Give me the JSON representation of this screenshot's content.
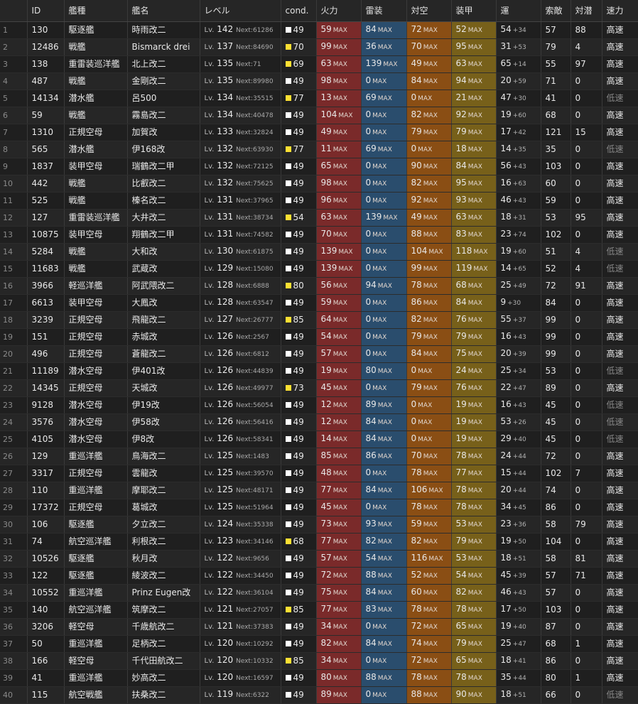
{
  "colors": {
    "fire": "#7a2a2a",
    "torp": "#2a4d6d",
    "aa": "#8a4e14",
    "armor": "#77601a",
    "cond_normal": "#ffffff",
    "cond_sparkle": "#ffe033"
  },
  "headers": [
    "",
    "ID",
    "艦種",
    "艦名",
    "レベル",
    "cond.",
    "火力",
    "雷装",
    "対空",
    "装甲",
    "運",
    "索敵",
    "対潜",
    "速力"
  ],
  "labels": {
    "lv": "Lv.",
    "next": "Next:",
    "max": "MAX"
  },
  "ships": [
    {
      "idx": "1",
      "id": "130",
      "type": "駆逐艦",
      "name": "時雨改二",
      "lv": "142",
      "next": "61286",
      "cond": "49",
      "fire": "59",
      "torp": "84",
      "aa": "72",
      "armor": "52",
      "luck": "54",
      "luck_bonus": "+34",
      "los": "57",
      "asw": "88",
      "speed": "高速"
    },
    {
      "idx": "2",
      "id": "12486",
      "type": "戦艦",
      "name": "Bismarck drei",
      "lv": "137",
      "next": "84690",
      "cond": "70",
      "fire": "99",
      "torp": "36",
      "aa": "70",
      "armor": "95",
      "luck": "31",
      "luck_bonus": "+53",
      "los": "79",
      "asw": "4",
      "speed": "高速"
    },
    {
      "idx": "3",
      "id": "138",
      "type": "重雷装巡洋艦",
      "name": "北上改二",
      "lv": "135",
      "next": "71",
      "cond": "69",
      "fire": "63",
      "torp": "139",
      "aa": "49",
      "armor": "63",
      "luck": "65",
      "luck_bonus": "+14",
      "los": "55",
      "asw": "97",
      "speed": "高速"
    },
    {
      "idx": "4",
      "id": "487",
      "type": "戦艦",
      "name": "金剛改二",
      "lv": "135",
      "next": "89980",
      "cond": "49",
      "fire": "98",
      "torp": "0",
      "aa": "84",
      "armor": "94",
      "luck": "20",
      "luck_bonus": "+59",
      "los": "71",
      "asw": "0",
      "speed": "高速"
    },
    {
      "idx": "5",
      "id": "14134",
      "type": "潜水艦",
      "name": "呂500",
      "lv": "134",
      "next": "35515",
      "cond": "77",
      "fire": "13",
      "torp": "69",
      "aa": "0",
      "armor": "21",
      "luck": "47",
      "luck_bonus": "+30",
      "los": "41",
      "asw": "0",
      "speed": "低速"
    },
    {
      "idx": "6",
      "id": "59",
      "type": "戦艦",
      "name": "霧島改二",
      "lv": "134",
      "next": "40478",
      "cond": "49",
      "fire": "104",
      "torp": "0",
      "aa": "82",
      "armor": "92",
      "luck": "19",
      "luck_bonus": "+60",
      "los": "68",
      "asw": "0",
      "speed": "高速"
    },
    {
      "idx": "7",
      "id": "1310",
      "type": "正規空母",
      "name": "加賀改",
      "lv": "133",
      "next": "32824",
      "cond": "49",
      "fire": "49",
      "torp": "0",
      "aa": "79",
      "armor": "79",
      "luck": "17",
      "luck_bonus": "+42",
      "los": "121",
      "asw": "15",
      "speed": "高速"
    },
    {
      "idx": "8",
      "id": "565",
      "type": "潜水艦",
      "name": "伊168改",
      "lv": "132",
      "next": "63930",
      "cond": "77",
      "fire": "11",
      "torp": "69",
      "aa": "0",
      "armor": "18",
      "luck": "14",
      "luck_bonus": "+35",
      "los": "35",
      "asw": "0",
      "speed": "低速"
    },
    {
      "idx": "9",
      "id": "1837",
      "type": "装甲空母",
      "name": "瑞鶴改二甲",
      "lv": "132",
      "next": "72125",
      "cond": "49",
      "fire": "65",
      "torp": "0",
      "aa": "90",
      "armor": "84",
      "luck": "56",
      "luck_bonus": "+43",
      "los": "103",
      "asw": "0",
      "speed": "高速"
    },
    {
      "idx": "10",
      "id": "442",
      "type": "戦艦",
      "name": "比叡改二",
      "lv": "132",
      "next": "75625",
      "cond": "49",
      "fire": "98",
      "torp": "0",
      "aa": "82",
      "armor": "95",
      "luck": "16",
      "luck_bonus": "+63",
      "los": "60",
      "asw": "0",
      "speed": "高速"
    },
    {
      "idx": "11",
      "id": "525",
      "type": "戦艦",
      "name": "榛名改二",
      "lv": "131",
      "next": "37965",
      "cond": "49",
      "fire": "96",
      "torp": "0",
      "aa": "92",
      "armor": "93",
      "luck": "46",
      "luck_bonus": "+43",
      "los": "59",
      "asw": "0",
      "speed": "高速"
    },
    {
      "idx": "12",
      "id": "127",
      "type": "重雷装巡洋艦",
      "name": "大井改二",
      "lv": "131",
      "next": "38734",
      "cond": "54",
      "fire": "63",
      "torp": "139",
      "aa": "49",
      "armor": "63",
      "luck": "18",
      "luck_bonus": "+31",
      "los": "53",
      "asw": "95",
      "speed": "高速"
    },
    {
      "idx": "13",
      "id": "10875",
      "type": "装甲空母",
      "name": "翔鶴改二甲",
      "lv": "131",
      "next": "74582",
      "cond": "49",
      "fire": "70",
      "torp": "0",
      "aa": "88",
      "armor": "83",
      "luck": "23",
      "luck_bonus": "+74",
      "los": "102",
      "asw": "0",
      "speed": "高速"
    },
    {
      "idx": "14",
      "id": "5284",
      "type": "戦艦",
      "name": "大和改",
      "lv": "130",
      "next": "61875",
      "cond": "49",
      "fire": "139",
      "torp": "0",
      "aa": "104",
      "armor": "118",
      "luck": "19",
      "luck_bonus": "+60",
      "los": "51",
      "asw": "4",
      "speed": "低速"
    },
    {
      "idx": "15",
      "id": "11683",
      "type": "戦艦",
      "name": "武蔵改",
      "lv": "129",
      "next": "15080",
      "cond": "49",
      "fire": "139",
      "torp": "0",
      "aa": "99",
      "armor": "119",
      "luck": "14",
      "luck_bonus": "+65",
      "los": "52",
      "asw": "4",
      "speed": "低速"
    },
    {
      "idx": "16",
      "id": "3966",
      "type": "軽巡洋艦",
      "name": "阿武隈改二",
      "lv": "128",
      "next": "6888",
      "cond": "80",
      "fire": "56",
      "torp": "94",
      "aa": "78",
      "armor": "68",
      "luck": "25",
      "luck_bonus": "+49",
      "los": "72",
      "asw": "91",
      "speed": "高速"
    },
    {
      "idx": "17",
      "id": "6613",
      "type": "装甲空母",
      "name": "大鳳改",
      "lv": "128",
      "next": "63547",
      "cond": "49",
      "fire": "59",
      "torp": "0",
      "aa": "86",
      "armor": "84",
      "luck": "9",
      "luck_bonus": "+30",
      "los": "84",
      "asw": "0",
      "speed": "高速"
    },
    {
      "idx": "18",
      "id": "3239",
      "type": "正規空母",
      "name": "飛龍改二",
      "lv": "127",
      "next": "26777",
      "cond": "85",
      "fire": "64",
      "torp": "0",
      "aa": "82",
      "armor": "76",
      "luck": "55",
      "luck_bonus": "+37",
      "los": "99",
      "asw": "0",
      "speed": "高速"
    },
    {
      "idx": "19",
      "id": "151",
      "type": "正規空母",
      "name": "赤城改",
      "lv": "126",
      "next": "2567",
      "cond": "49",
      "fire": "54",
      "torp": "0",
      "aa": "79",
      "armor": "79",
      "luck": "16",
      "luck_bonus": "+43",
      "los": "99",
      "asw": "0",
      "speed": "高速"
    },
    {
      "idx": "20",
      "id": "496",
      "type": "正規空母",
      "name": "蒼龍改二",
      "lv": "126",
      "next": "6812",
      "cond": "49",
      "fire": "57",
      "torp": "0",
      "aa": "84",
      "armor": "75",
      "luck": "20",
      "luck_bonus": "+39",
      "los": "99",
      "asw": "0",
      "speed": "高速"
    },
    {
      "idx": "21",
      "id": "11189",
      "type": "潜水空母",
      "name": "伊401改",
      "lv": "126",
      "next": "44839",
      "cond": "49",
      "fire": "19",
      "torp": "80",
      "aa": "0",
      "armor": "24",
      "luck": "25",
      "luck_bonus": "+34",
      "los": "53",
      "asw": "0",
      "speed": "低速"
    },
    {
      "idx": "22",
      "id": "14345",
      "type": "正規空母",
      "name": "天城改",
      "lv": "126",
      "next": "49977",
      "cond": "73",
      "fire": "45",
      "torp": "0",
      "aa": "79",
      "armor": "76",
      "luck": "22",
      "luck_bonus": "+47",
      "los": "89",
      "asw": "0",
      "speed": "高速"
    },
    {
      "idx": "23",
      "id": "9128",
      "type": "潜水空母",
      "name": "伊19改",
      "lv": "126",
      "next": "56054",
      "cond": "49",
      "fire": "12",
      "torp": "89",
      "aa": "0",
      "armor": "19",
      "luck": "16",
      "luck_bonus": "+43",
      "los": "45",
      "asw": "0",
      "speed": "低速"
    },
    {
      "idx": "24",
      "id": "3576",
      "type": "潜水空母",
      "name": "伊58改",
      "lv": "126",
      "next": "56416",
      "cond": "49",
      "fire": "12",
      "torp": "84",
      "aa": "0",
      "armor": "19",
      "luck": "53",
      "luck_bonus": "+26",
      "los": "45",
      "asw": "0",
      "speed": "低速"
    },
    {
      "idx": "25",
      "id": "4105",
      "type": "潜水空母",
      "name": "伊8改",
      "lv": "126",
      "next": "58341",
      "cond": "49",
      "fire": "14",
      "torp": "84",
      "aa": "0",
      "armor": "19",
      "luck": "29",
      "luck_bonus": "+40",
      "los": "45",
      "asw": "0",
      "speed": "低速"
    },
    {
      "idx": "26",
      "id": "129",
      "type": "重巡洋艦",
      "name": "鳥海改二",
      "lv": "125",
      "next": "1483",
      "cond": "49",
      "fire": "85",
      "torp": "86",
      "aa": "70",
      "armor": "78",
      "luck": "24",
      "luck_bonus": "+44",
      "los": "72",
      "asw": "0",
      "speed": "高速"
    },
    {
      "idx": "27",
      "id": "3317",
      "type": "正規空母",
      "name": "雲龍改",
      "lv": "125",
      "next": "39570",
      "cond": "49",
      "fire": "48",
      "torp": "0",
      "aa": "78",
      "armor": "77",
      "luck": "15",
      "luck_bonus": "+44",
      "los": "102",
      "asw": "7",
      "speed": "高速"
    },
    {
      "idx": "28",
      "id": "110",
      "type": "重巡洋艦",
      "name": "摩耶改二",
      "lv": "125",
      "next": "48171",
      "cond": "49",
      "fire": "77",
      "torp": "84",
      "aa": "106",
      "armor": "78",
      "luck": "20",
      "luck_bonus": "+44",
      "los": "74",
      "asw": "0",
      "speed": "高速"
    },
    {
      "idx": "29",
      "id": "17372",
      "type": "正規空母",
      "name": "葛城改",
      "lv": "125",
      "next": "51964",
      "cond": "49",
      "fire": "45",
      "torp": "0",
      "aa": "78",
      "armor": "78",
      "luck": "34",
      "luck_bonus": "+45",
      "los": "86",
      "asw": "0",
      "speed": "高速"
    },
    {
      "idx": "30",
      "id": "106",
      "type": "駆逐艦",
      "name": "夕立改二",
      "lv": "124",
      "next": "35338",
      "cond": "49",
      "fire": "73",
      "torp": "93",
      "aa": "59",
      "armor": "53",
      "luck": "23",
      "luck_bonus": "+36",
      "los": "58",
      "asw": "79",
      "speed": "高速"
    },
    {
      "idx": "31",
      "id": "74",
      "type": "航空巡洋艦",
      "name": "利根改二",
      "lv": "123",
      "next": "34146",
      "cond": "68",
      "fire": "77",
      "torp": "82",
      "aa": "82",
      "armor": "79",
      "luck": "19",
      "luck_bonus": "+50",
      "los": "104",
      "asw": "0",
      "speed": "高速"
    },
    {
      "idx": "32",
      "id": "10526",
      "type": "駆逐艦",
      "name": "秋月改",
      "lv": "122",
      "next": "9656",
      "cond": "49",
      "fire": "57",
      "torp": "54",
      "aa": "116",
      "armor": "53",
      "luck": "18",
      "luck_bonus": "+51",
      "los": "58",
      "asw": "81",
      "speed": "高速"
    },
    {
      "idx": "33",
      "id": "122",
      "type": "駆逐艦",
      "name": "綾波改二",
      "lv": "122",
      "next": "34450",
      "cond": "49",
      "fire": "72",
      "torp": "88",
      "aa": "52",
      "armor": "54",
      "luck": "45",
      "luck_bonus": "+39",
      "los": "57",
      "asw": "71",
      "speed": "高速"
    },
    {
      "idx": "34",
      "id": "10552",
      "type": "重巡洋艦",
      "name": "Prinz Eugen改",
      "lv": "122",
      "next": "36104",
      "cond": "49",
      "fire": "75",
      "torp": "84",
      "aa": "60",
      "armor": "82",
      "luck": "46",
      "luck_bonus": "+43",
      "los": "57",
      "asw": "0",
      "speed": "高速"
    },
    {
      "idx": "35",
      "id": "140",
      "type": "航空巡洋艦",
      "name": "筑摩改二",
      "lv": "121",
      "next": "27057",
      "cond": "85",
      "fire": "77",
      "torp": "83",
      "aa": "78",
      "armor": "78",
      "luck": "17",
      "luck_bonus": "+50",
      "los": "103",
      "asw": "0",
      "speed": "高速"
    },
    {
      "idx": "36",
      "id": "3206",
      "type": "軽空母",
      "name": "千歳航改二",
      "lv": "121",
      "next": "37383",
      "cond": "49",
      "fire": "34",
      "torp": "0",
      "aa": "72",
      "armor": "65",
      "luck": "19",
      "luck_bonus": "+40",
      "los": "87",
      "asw": "0",
      "speed": "高速"
    },
    {
      "idx": "37",
      "id": "50",
      "type": "重巡洋艦",
      "name": "足柄改二",
      "lv": "120",
      "next": "10292",
      "cond": "49",
      "fire": "82",
      "torp": "84",
      "aa": "74",
      "armor": "79",
      "luck": "25",
      "luck_bonus": "+47",
      "los": "68",
      "asw": "1",
      "speed": "高速"
    },
    {
      "idx": "38",
      "id": "166",
      "type": "軽空母",
      "name": "千代田航改二",
      "lv": "120",
      "next": "10332",
      "cond": "85",
      "fire": "34",
      "torp": "0",
      "aa": "72",
      "armor": "65",
      "luck": "18",
      "luck_bonus": "+41",
      "los": "86",
      "asw": "0",
      "speed": "高速"
    },
    {
      "idx": "39",
      "id": "41",
      "type": "重巡洋艦",
      "name": "妙高改二",
      "lv": "120",
      "next": "16597",
      "cond": "49",
      "fire": "80",
      "torp": "88",
      "aa": "78",
      "armor": "78",
      "luck": "35",
      "luck_bonus": "+44",
      "los": "80",
      "asw": "1",
      "speed": "高速"
    },
    {
      "idx": "40",
      "id": "115",
      "type": "航空戦艦",
      "name": "扶桑改二",
      "lv": "119",
      "next": "6322",
      "cond": "49",
      "fire": "89",
      "torp": "0",
      "aa": "88",
      "armor": "90",
      "luck": "18",
      "luck_bonus": "+51",
      "los": "66",
      "asw": "0",
      "speed": "低速"
    }
  ]
}
